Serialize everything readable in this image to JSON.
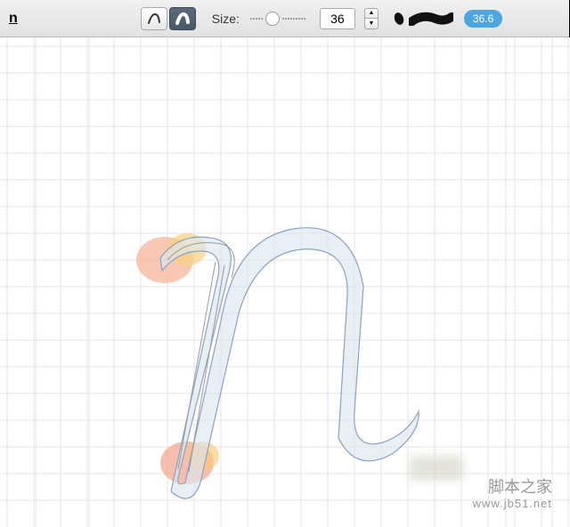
{
  "toolbar": {
    "character": "n",
    "sizeLabel": "Size:",
    "sizeValue": "36",
    "brushValue": "36.6"
  },
  "watermark": {
    "title": "脚本之家",
    "url": "www.jb51.net"
  }
}
